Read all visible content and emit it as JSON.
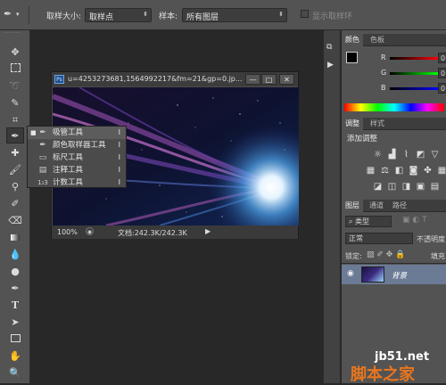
{
  "options_bar": {
    "sample_size_label": "取样大小:",
    "sample_size_value": "取样点",
    "sample_label": "样本:",
    "sample_value": "所有图层",
    "show_ring_label": "显示取样环"
  },
  "document": {
    "title": "u=4253273681,1564992217&fm=21&gp=0.jp...",
    "zoom": "100%",
    "doc_info": "文档:242.3K/242.3K"
  },
  "flyout": {
    "items": [
      {
        "label": "吸管工具",
        "key": "I",
        "icon": "eyedropper-icon",
        "selected": true
      },
      {
        "label": "颜色取样器工具",
        "key": "I",
        "icon": "color-sampler-icon",
        "selected": false
      },
      {
        "label": "标尺工具",
        "key": "I",
        "icon": "ruler-icon",
        "selected": false
      },
      {
        "label": "注释工具",
        "key": "I",
        "icon": "note-icon",
        "selected": false
      },
      {
        "label": "计数工具",
        "key": "I",
        "icon": "count-icon",
        "selected": false
      }
    ]
  },
  "color_panel": {
    "tabs": [
      "颜色",
      "色板"
    ],
    "channels": [
      {
        "label": "R",
        "value": "0"
      },
      {
        "label": "G",
        "value": "0"
      },
      {
        "label": "B",
        "value": "0"
      }
    ]
  },
  "adjust_panel": {
    "tabs": [
      "调整",
      "样式"
    ],
    "heading": "添加调整"
  },
  "layers_panel": {
    "tabs": [
      "图层",
      "通道",
      "路径"
    ],
    "filter_label": "类型",
    "blend_mode": "正常",
    "opacity_label": "不透明度",
    "lock_label": "锁定:",
    "fill_label": "填充",
    "layer_name": "背景"
  },
  "watermark": {
    "site": "jb51.net",
    "name": "脚本之家"
  },
  "colors": {
    "ui_dark": "#282828",
    "ui_panel": "#535353",
    "selection": "#6b7a95",
    "watermark_orange": "#e8761f"
  }
}
